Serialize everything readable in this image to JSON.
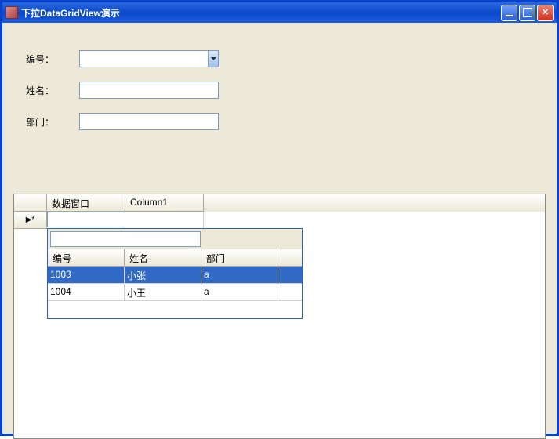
{
  "window": {
    "title": "下拉DataGridView演示"
  },
  "form": {
    "id_label": "编号：",
    "name_label": "姓名：",
    "dept_label": "部门：",
    "id_value": "",
    "name_value": "",
    "dept_value": ""
  },
  "grid": {
    "row_indicator": "▶*",
    "columns": {
      "col1": "数据窗口",
      "col2": "Column1"
    },
    "cell_combo_value": ""
  },
  "popup": {
    "search_value": "",
    "headers": {
      "id": "编号",
      "name": "姓名",
      "dept": "部门"
    },
    "rows": [
      {
        "id": "1003",
        "name": "小张",
        "dept": "a",
        "selected": true
      },
      {
        "id": "1004",
        "name": "小王",
        "dept": "a",
        "selected": false
      }
    ]
  }
}
